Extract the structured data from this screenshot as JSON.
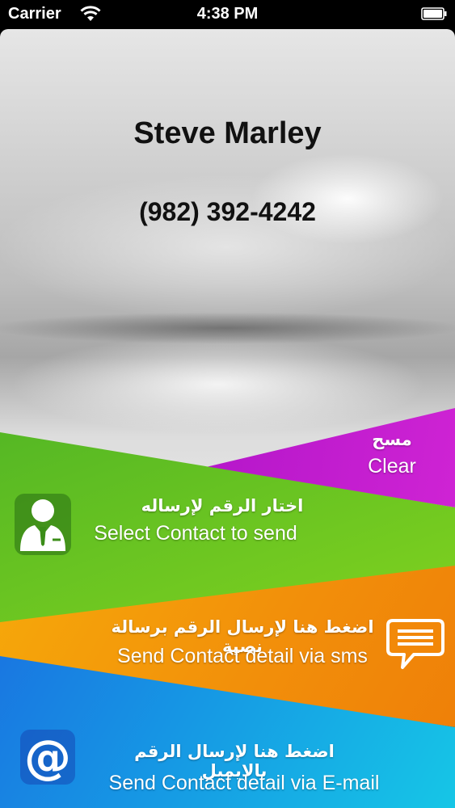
{
  "status_bar": {
    "carrier": "Carrier",
    "time": "4:38 PM"
  },
  "contact": {
    "name": "Steve Marley",
    "phone": "(982) 392-4242"
  },
  "actions": {
    "clear": {
      "label_ar": "مسح",
      "label_en": "Clear",
      "color": "#b316c9"
    },
    "select_contact": {
      "label_ar": "اختار الرقم لإرساله",
      "label_en": "Select Contact to send",
      "color": "#56b824",
      "icon": "person-icon"
    },
    "send_sms": {
      "label_ar": "اضغط هنا لإرسال الرقم برسالة نصية",
      "label_en": "Send Contact detail via sms",
      "color": "#f6a90a",
      "icon": "chat-bubble-icon"
    },
    "send_email": {
      "label_ar": "اضغط هنا لإرسال الرقم بالايميل",
      "label_en": "Send Contact detail via E-mail",
      "color": "#1a6fe0",
      "icon": "at-sign-icon"
    }
  }
}
